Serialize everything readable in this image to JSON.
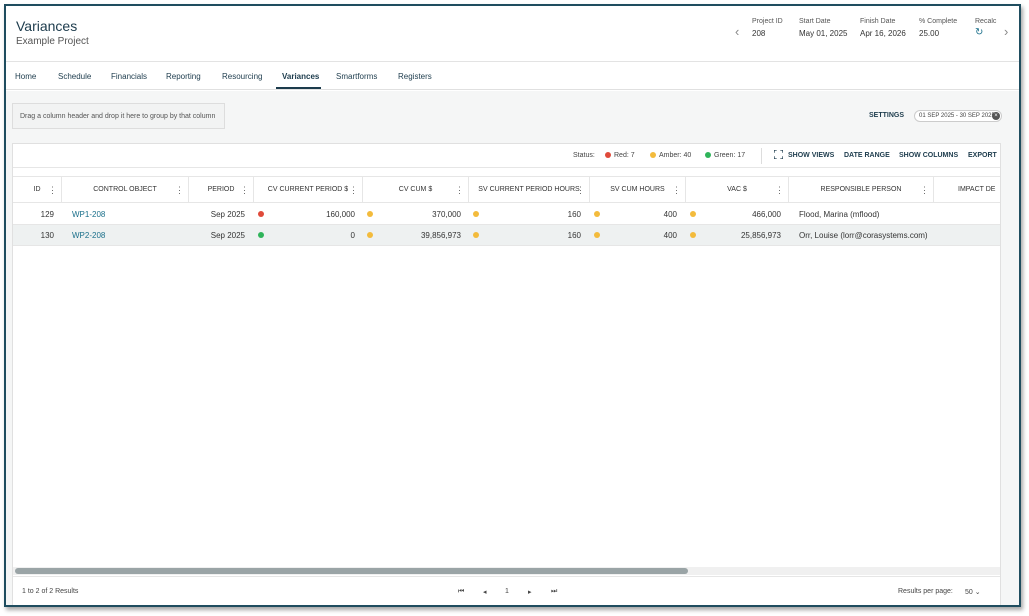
{
  "header": {
    "title": "Variances",
    "subtitle": "Example Project",
    "project_id_label": "Project ID",
    "project_id": "208",
    "start_label": "Start Date",
    "start_date": "May 01, 2025",
    "finish_label": "Finish Date",
    "finish_date": "Apr 16, 2026",
    "complete_label": "% Complete",
    "complete_value": "25.00",
    "recalc_label": "Recalc"
  },
  "tabs": [
    {
      "label": "Home"
    },
    {
      "label": "Schedule"
    },
    {
      "label": "Financials"
    },
    {
      "label": "Reporting"
    },
    {
      "label": "Resourcing"
    },
    {
      "label": "Variances",
      "active": true
    },
    {
      "label": "Smartforms"
    },
    {
      "label": "Registers"
    }
  ],
  "group_hint": "Drag a column header and drop it here to group by that column",
  "settings_label": "SETTINGS",
  "date_range_value": "01 SEP 2025 - 30 SEP 2025",
  "toolbar": {
    "status_label": "Status:",
    "red": "Red: 7",
    "amber": "Amber: 40",
    "green": "Green: 17",
    "show_views": "SHOW VIEWS",
    "date_range": "DATE RANGE",
    "show_columns": "SHOW COLUMNS",
    "export": "EXPORT"
  },
  "colors": {
    "red": "#e04a3a",
    "amber": "#f3bb3c",
    "green": "#2fb45a",
    "accent": "#1c3b4c",
    "link": "#1a6f8a"
  },
  "columns": [
    "ID",
    "CONTROL OBJECT",
    "PERIOD",
    "CV CURRENT PERIOD $",
    "CV CUM $",
    "SV CURRENT PERIOD HOURS",
    "SV CUM HOURS",
    "VAC $",
    "RESPONSIBLE PERSON",
    "IMPACT DE"
  ],
  "rows": [
    {
      "id": "129",
      "control_object": "WP1-208",
      "period": "Sep 2025",
      "cv_current": "160,000",
      "cv_cum": "370,000",
      "sv_current": "160",
      "sv_cum": "400",
      "vac": "466,000",
      "person": "Flood, Marina (mflood)"
    },
    {
      "id": "130",
      "control_object": "WP2-208",
      "period": "Sep 2025",
      "cv_current": "0",
      "cv_cum": "39,856,973",
      "sv_current": "160",
      "sv_cum": "400",
      "vac": "25,856,973",
      "person": "Orr, Louise (lorr@corasystems.com)"
    }
  ],
  "footer": {
    "results_text": "1 to 2 of 2 Results",
    "page": "1",
    "per_page_label": "Results per page:",
    "per_page_value": "50"
  }
}
